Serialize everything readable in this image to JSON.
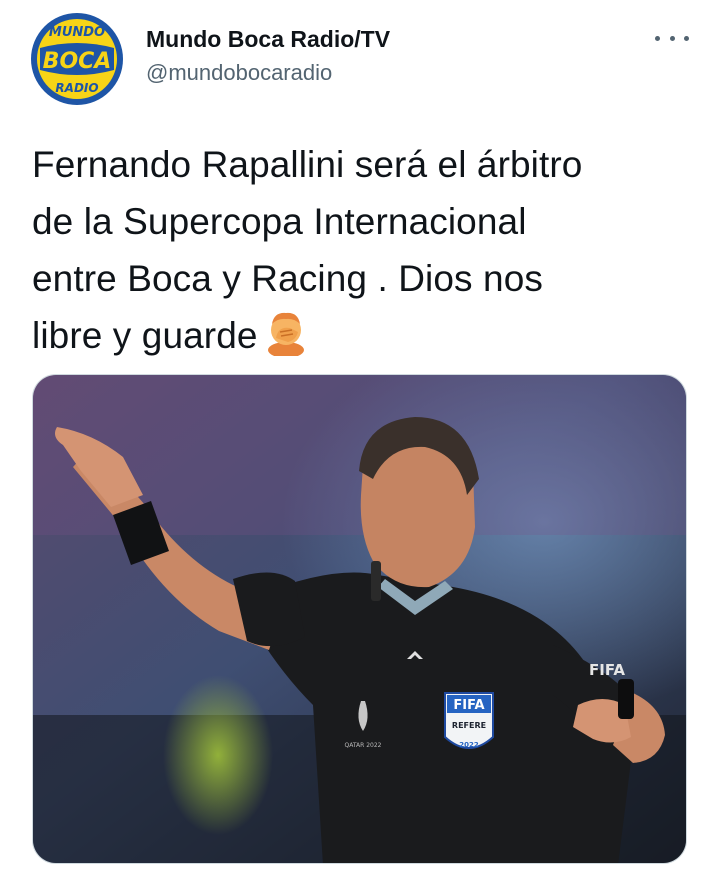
{
  "account": {
    "display_name": "Mundo Boca Radio/TV",
    "handle": "@mundobocaradio",
    "avatar_lines": [
      "MUNDO",
      "BOCA",
      "RADIO"
    ]
  },
  "tweet": {
    "text_lines": [
      "Fernando Rapallini será el árbitro",
      "de la Supercopa Internacional",
      "entre Boca y Racing . Dios nos",
      "libre y guarde"
    ],
    "emoji": "face-palm-emoji"
  },
  "media": {
    "sleeve_text": "FIFA",
    "badge_text": [
      "FIFA",
      "REFERE",
      "2022"
    ],
    "crest_text": "QATAR 2022"
  },
  "colors": {
    "avatar_blue": "#1e55a6",
    "avatar_yellow": "#f7d417",
    "handle_gray": "#536471"
  }
}
